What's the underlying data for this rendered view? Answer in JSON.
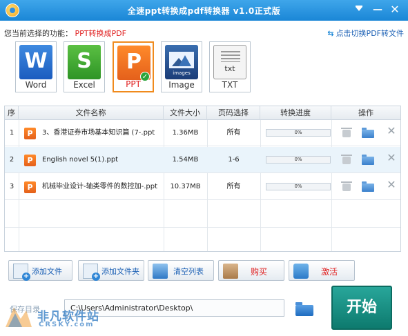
{
  "window": {
    "title": "全速ppt转换成pdf转换器 v1.0正式版"
  },
  "function_bar": {
    "label": "您当前选择的功能：",
    "value": "PPT转换成PDF",
    "switch_link": "点击切换PDF转文件"
  },
  "formats": [
    {
      "key": "word",
      "label": "Word",
      "glyph": "W"
    },
    {
      "key": "excel",
      "label": "Excel",
      "glyph": "S"
    },
    {
      "key": "ppt",
      "label": "PPT",
      "glyph": "P",
      "selected": true
    },
    {
      "key": "image",
      "label": "Image",
      "caption": "images"
    },
    {
      "key": "txt",
      "label": "TXT",
      "caption": "txt"
    }
  ],
  "table": {
    "columns": [
      "序",
      "文件名称",
      "文件大小",
      "页码选择",
      "转换进度",
      "操作"
    ],
    "rows": [
      {
        "index": "1",
        "name": "3、香港证券市场基本知识篇 (7-.ppt",
        "size": "1.36MB",
        "pages": "所有",
        "progress_label": "0%",
        "progress": 0
      },
      {
        "index": "2",
        "name": "English novel 5(1).ppt",
        "size": "1.54MB",
        "pages": "1-6",
        "progress_label": "0%",
        "progress": 0,
        "selected": true
      },
      {
        "index": "3",
        "name": "机械毕业设计-轴类零件的数控加-.ppt",
        "size": "10.37MB",
        "pages": "所有",
        "progress_label": "0%",
        "progress": 0
      }
    ]
  },
  "buttons": {
    "add_file": "添加文件",
    "add_folder": "添加文件夹",
    "clear_list": "清空列表",
    "buy": "购买",
    "activate": "激活",
    "start": "开始"
  },
  "save": {
    "label": "保存目录",
    "path": "C:\\Users\\Administrator\\Desktop\\"
  },
  "watermark": {
    "text": "非凡软件站",
    "sub": "CRSKY.com"
  },
  "colors": {
    "titlebar": "#1a86d6",
    "accent_red": "#e02020",
    "start_button": "#0d7a6e",
    "ppt_orange": "#e4601b"
  }
}
